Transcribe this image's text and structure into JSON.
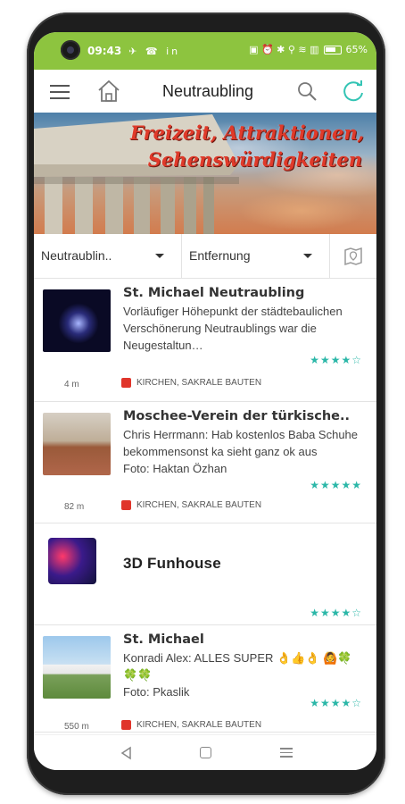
{
  "status_bar": {
    "time": "09:43",
    "left_icons": "✈ ☎ in",
    "right_icons": "▣ ⏰ ✱ ⚲ ≋ ▥",
    "battery": "65%"
  },
  "app_bar": {
    "title": "Neutraubling"
  },
  "banner": {
    "line1": "Freizeit, Attraktionen,",
    "line2": "Sehenswürdigkeiten"
  },
  "filters": {
    "location": "Neutraublin..",
    "sort": "Entfernung"
  },
  "list": [
    {
      "title": "St. Michael Neutraubling",
      "description": "Vorläufiger Höhepunkt der städtebaulichen Verschönerung Neutraublings war die Neugestaltun…",
      "rating": 4,
      "distance": "4 m",
      "category": "KIRCHEN, SAKRALE BAUTEN"
    },
    {
      "title": "Moschee-Verein der türkische..",
      "description": "Chris Herrmann: Hab kostenlos Baba Schuhe bekommensonst ka sieht ganz ok aus",
      "photo_credit": "Foto: Haktan Özhan",
      "rating": 5,
      "distance": "82 m",
      "category": "KIRCHEN, SAKRALE BAUTEN"
    },
    {
      "title": "3D Funhouse",
      "rating": 4
    },
    {
      "title": "St. Michael",
      "description": "Konradi Alex: ALLES SUPER 👌👍👌 🙆🍀🍀🍀",
      "photo_credit": "Foto: Pkaslik",
      "rating": 4,
      "distance": "550 m",
      "category": "KIRCHEN, SAKRALE BAUTEN"
    }
  ],
  "stars_text": {
    "four": "★★★★☆",
    "five": "★★★★★"
  },
  "colors": {
    "status_bar": "#8dc43f",
    "accent_teal": "#2bb7a8",
    "category_red": "#e0352b"
  },
  "icons": [
    "hamburger-menu-icon",
    "home-icon",
    "search-icon",
    "refresh-icon",
    "map-bookmark-icon",
    "back-icon",
    "home-nav-icon",
    "recent-apps-icon"
  ]
}
